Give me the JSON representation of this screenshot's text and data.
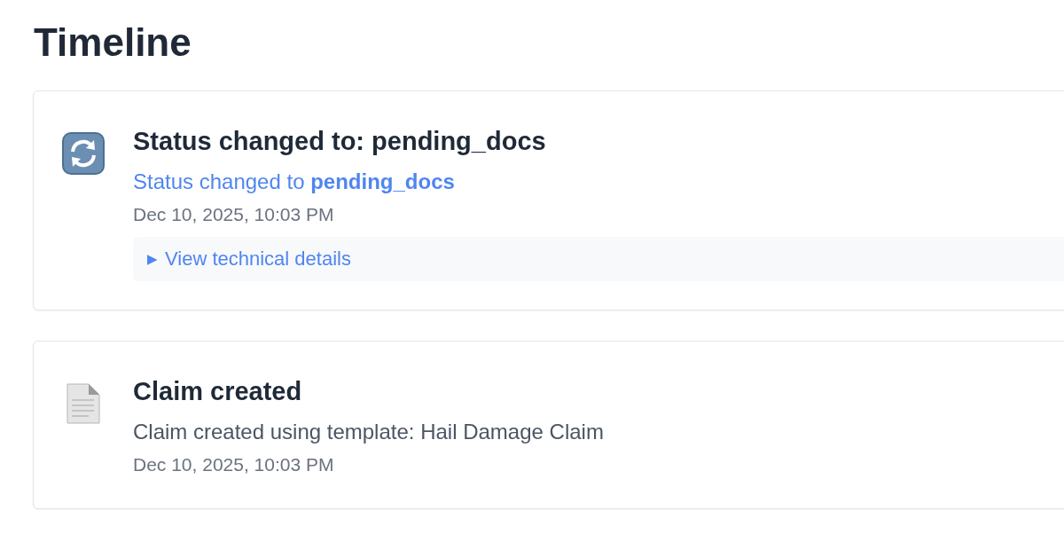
{
  "title": "Timeline",
  "events": [
    {
      "kind": "status",
      "title": "Status changed to: pending_docs",
      "description": "Status changed to **pending_docs**",
      "time": "Dec 10, 2025, 10:03 PM",
      "details": {
        "marker": "▶",
        "label": "View technical details",
        "expanded": false
      }
    },
    {
      "kind": "created",
      "title": "Claim created",
      "description": "Claim created using template: Hail Damage Claim",
      "time": "Dec 10, 2025, 10:03 PM"
    }
  ]
}
